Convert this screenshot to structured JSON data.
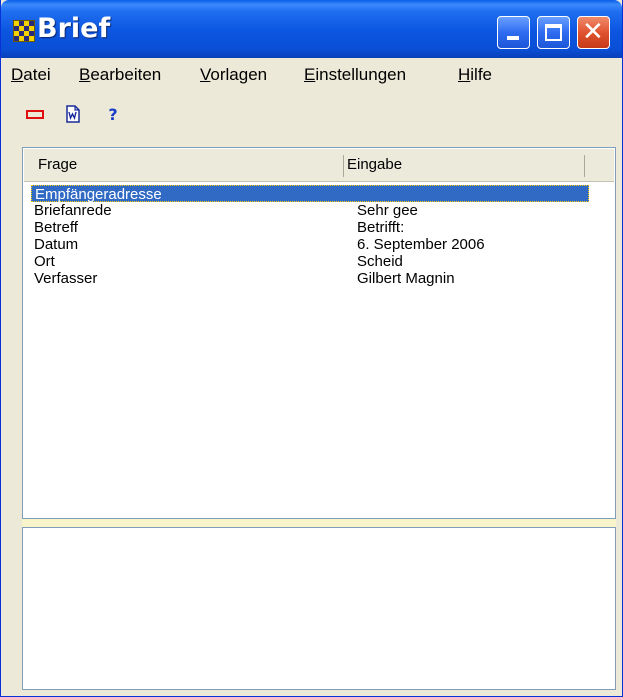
{
  "window": {
    "title": "Brief",
    "title_color": "#ffffff",
    "titlebar_color": "#0a4fd6"
  },
  "menu": {
    "items": [
      {
        "label": "Datei"
      },
      {
        "label": "Bearbeiten"
      },
      {
        "label": "Vorlagen"
      },
      {
        "label": "Einstellungen"
      },
      {
        "label": "Hilfe"
      }
    ]
  },
  "toolbar": {
    "buttons": [
      {
        "icon": "red-rectangle-icon"
      },
      {
        "icon": "word-document-icon"
      },
      {
        "icon": "help-icon",
        "glyph": "?"
      }
    ]
  },
  "table": {
    "columns": [
      "Frage",
      "Eingabe"
    ],
    "rows": [
      {
        "frage": "Empfängeradresse",
        "eingabe": "",
        "selected": true
      },
      {
        "frage": "Briefanrede",
        "eingabe": "Sehr gee"
      },
      {
        "frage": "Betreff",
        "eingabe": "Betrifft:"
      },
      {
        "frage": "Datum",
        "eingabe": "6. September 2006"
      },
      {
        "frage": "Ort",
        "eingabe": "Scheid"
      },
      {
        "frage": "Verfasser",
        "eingabe": "Gilbert Magnin"
      }
    ],
    "selection_color": "#316ac5"
  }
}
